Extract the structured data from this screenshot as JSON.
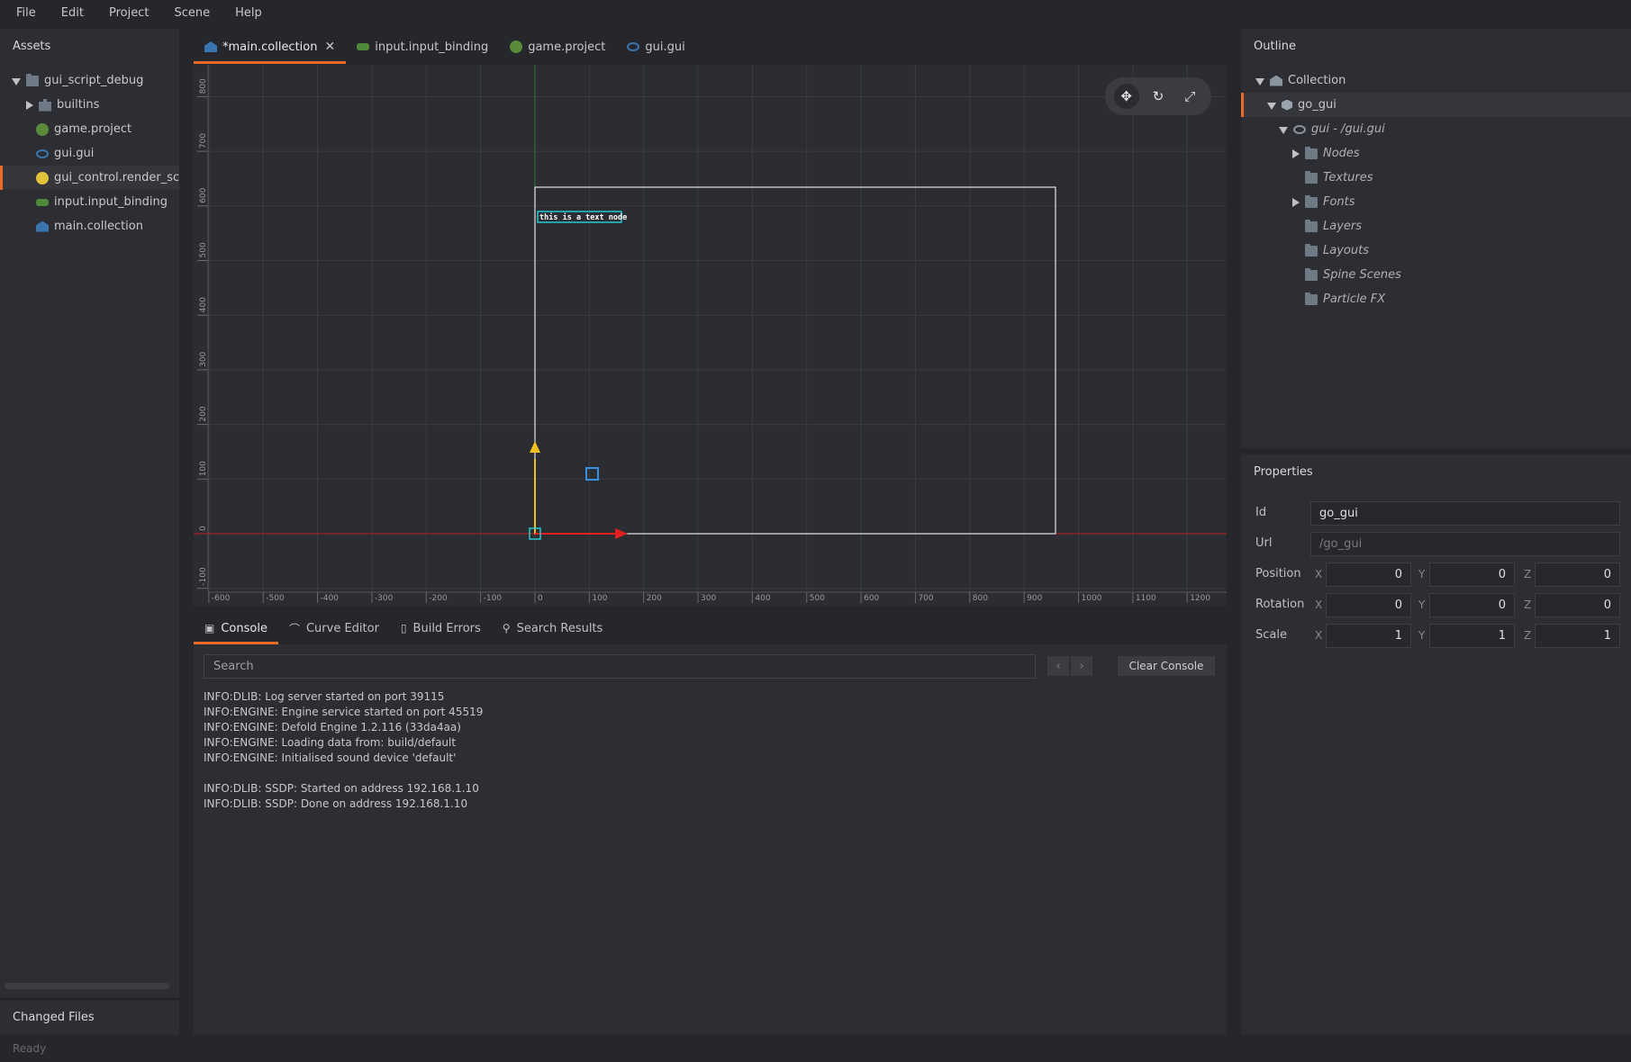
{
  "menu": [
    "File",
    "Edit",
    "Project",
    "Scene",
    "Help"
  ],
  "assets": {
    "title": "Assets",
    "items": [
      {
        "label": "gui_script_debug",
        "icon": "folder-icon",
        "arrow": "down"
      },
      {
        "label": "builtins",
        "icon": "puzzle-icon",
        "arrow": "right"
      },
      {
        "label": "game.project",
        "icon": "gear-icon",
        "arrow": "none"
      },
      {
        "label": "gui.gui",
        "icon": "gui-icon",
        "arrow": "none"
      },
      {
        "label": "gui_control.render_script",
        "icon": "gear-icon",
        "arrow": "none",
        "selected": true
      },
      {
        "label": "input.input_binding",
        "icon": "input-binding-icon",
        "arrow": "none"
      },
      {
        "label": "main.collection",
        "icon": "collection-icon",
        "arrow": "none"
      }
    ],
    "changed_files": "Changed Files"
  },
  "status": "Ready",
  "tabs": [
    {
      "label": "*main.collection",
      "icon": "collection-icon",
      "active": true,
      "close": "✕"
    },
    {
      "label": "input.input_binding",
      "icon": "input-binding-icon"
    },
    {
      "label": "game.project",
      "icon": "gear-icon"
    },
    {
      "label": "gui.gui",
      "icon": "gui-icon"
    }
  ],
  "viewport": {
    "text_node": "this is a text node",
    "x_ticks": [
      "-600",
      "-500",
      "-400",
      "-300",
      "-200",
      "-100",
      "0",
      "100",
      "200",
      "300",
      "400",
      "500",
      "600",
      "700",
      "800",
      "900",
      "1000",
      "1100",
      "1200"
    ],
    "y_ticks": [
      "800",
      "700",
      "600",
      "500",
      "400",
      "300",
      "200",
      "100",
      "0",
      "-100"
    ],
    "colors": {
      "x_axis": "#e02020",
      "y_axis": "#f0c020",
      "selection": "#25c8d0",
      "grid": "#3a3c42"
    }
  },
  "bottom_tabs": [
    {
      "label": "Console",
      "icon": "terminal-icon",
      "active": true
    },
    {
      "label": "Curve Editor",
      "icon": "curve-icon"
    },
    {
      "label": "Build Errors",
      "icon": "errors-icon"
    },
    {
      "label": "Search Results",
      "icon": "search-icon"
    }
  ],
  "console": {
    "search_placeholder": "Search",
    "clear_label": "Clear Console",
    "lines": [
      "INFO:DLIB: Log server started on port 39115",
      "INFO:ENGINE: Engine service started on port 45519",
      "INFO:ENGINE: Defold Engine 1.2.116 (33da4aa)",
      "INFO:ENGINE: Loading data from: build/default",
      "INFO:ENGINE: Initialised sound device 'default'",
      "",
      "INFO:DLIB: SSDP: Started on address 192.168.1.10",
      "INFO:DLIB: SSDP: Done on address 192.168.1.10"
    ]
  },
  "outline": {
    "title": "Outline",
    "items": [
      {
        "label": "Collection",
        "icon": "collection-icon",
        "arrow": "down",
        "indent": 0
      },
      {
        "label": "go_gui",
        "icon": "game-object-icon",
        "arrow": "down",
        "indent": 1,
        "selected": true
      },
      {
        "label": "gui - /gui.gui",
        "icon": "gui-icon",
        "arrow": "down",
        "indent": 2,
        "italic": true
      },
      {
        "label": "Nodes",
        "icon": "folder-icon",
        "arrow": "right",
        "indent": 3,
        "italic": true
      },
      {
        "label": "Textures",
        "icon": "folder-icon",
        "arrow": "none",
        "indent": 3,
        "italic": true
      },
      {
        "label": "Fonts",
        "icon": "folder-icon",
        "arrow": "right",
        "indent": 3,
        "italic": true
      },
      {
        "label": "Layers",
        "icon": "folder-icon",
        "arrow": "none",
        "indent": 3,
        "italic": true
      },
      {
        "label": "Layouts",
        "icon": "folder-icon",
        "arrow": "none",
        "indent": 3,
        "italic": true
      },
      {
        "label": "Spine Scenes",
        "icon": "folder-icon",
        "arrow": "none",
        "indent": 3,
        "italic": true
      },
      {
        "label": "Particle FX",
        "icon": "folder-icon",
        "arrow": "none",
        "indent": 3,
        "italic": true
      }
    ]
  },
  "properties": {
    "title": "Properties",
    "id_label": "Id",
    "id_value": "go_gui",
    "url_label": "Url",
    "url_value": "/go_gui",
    "axis": {
      "x": "X",
      "y": "Y",
      "z": "Z"
    },
    "position": {
      "label": "Position",
      "x": "0",
      "y": "0",
      "z": "0"
    },
    "rotation": {
      "label": "Rotation",
      "x": "0",
      "y": "0",
      "z": "0"
    },
    "scale": {
      "label": "Scale",
      "x": "1",
      "y": "1",
      "z": "1"
    }
  }
}
